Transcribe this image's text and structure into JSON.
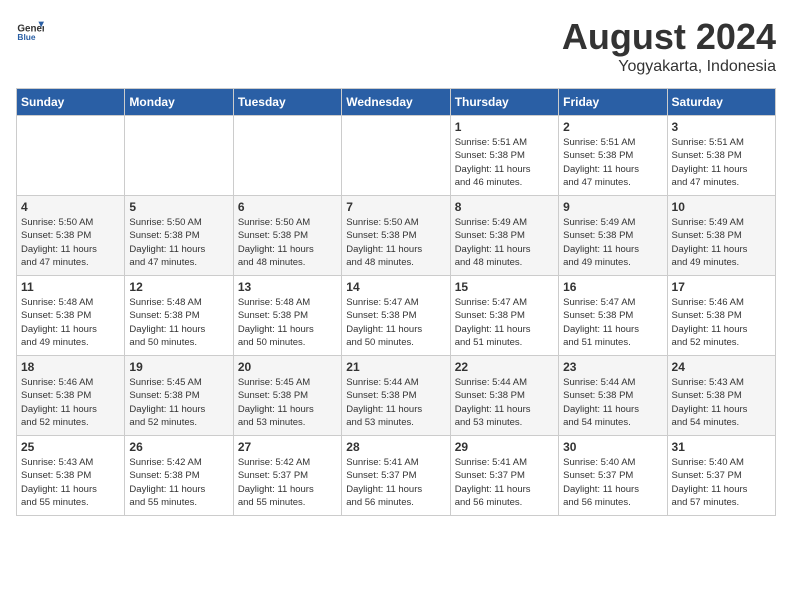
{
  "logo": {
    "general": "General",
    "blue": "Blue"
  },
  "title": "August 2024",
  "subtitle": "Yogyakarta, Indonesia",
  "days_of_week": [
    "Sunday",
    "Monday",
    "Tuesday",
    "Wednesday",
    "Thursday",
    "Friday",
    "Saturday"
  ],
  "weeks": [
    [
      {
        "day": "",
        "info": ""
      },
      {
        "day": "",
        "info": ""
      },
      {
        "day": "",
        "info": ""
      },
      {
        "day": "",
        "info": ""
      },
      {
        "day": "1",
        "info": "Sunrise: 5:51 AM\nSunset: 5:38 PM\nDaylight: 11 hours\nand 46 minutes."
      },
      {
        "day": "2",
        "info": "Sunrise: 5:51 AM\nSunset: 5:38 PM\nDaylight: 11 hours\nand 47 minutes."
      },
      {
        "day": "3",
        "info": "Sunrise: 5:51 AM\nSunset: 5:38 PM\nDaylight: 11 hours\nand 47 minutes."
      }
    ],
    [
      {
        "day": "4",
        "info": "Sunrise: 5:50 AM\nSunset: 5:38 PM\nDaylight: 11 hours\nand 47 minutes."
      },
      {
        "day": "5",
        "info": "Sunrise: 5:50 AM\nSunset: 5:38 PM\nDaylight: 11 hours\nand 47 minutes."
      },
      {
        "day": "6",
        "info": "Sunrise: 5:50 AM\nSunset: 5:38 PM\nDaylight: 11 hours\nand 48 minutes."
      },
      {
        "day": "7",
        "info": "Sunrise: 5:50 AM\nSunset: 5:38 PM\nDaylight: 11 hours\nand 48 minutes."
      },
      {
        "day": "8",
        "info": "Sunrise: 5:49 AM\nSunset: 5:38 PM\nDaylight: 11 hours\nand 48 minutes."
      },
      {
        "day": "9",
        "info": "Sunrise: 5:49 AM\nSunset: 5:38 PM\nDaylight: 11 hours\nand 49 minutes."
      },
      {
        "day": "10",
        "info": "Sunrise: 5:49 AM\nSunset: 5:38 PM\nDaylight: 11 hours\nand 49 minutes."
      }
    ],
    [
      {
        "day": "11",
        "info": "Sunrise: 5:48 AM\nSunset: 5:38 PM\nDaylight: 11 hours\nand 49 minutes."
      },
      {
        "day": "12",
        "info": "Sunrise: 5:48 AM\nSunset: 5:38 PM\nDaylight: 11 hours\nand 50 minutes."
      },
      {
        "day": "13",
        "info": "Sunrise: 5:48 AM\nSunset: 5:38 PM\nDaylight: 11 hours\nand 50 minutes."
      },
      {
        "day": "14",
        "info": "Sunrise: 5:47 AM\nSunset: 5:38 PM\nDaylight: 11 hours\nand 50 minutes."
      },
      {
        "day": "15",
        "info": "Sunrise: 5:47 AM\nSunset: 5:38 PM\nDaylight: 11 hours\nand 51 minutes."
      },
      {
        "day": "16",
        "info": "Sunrise: 5:47 AM\nSunset: 5:38 PM\nDaylight: 11 hours\nand 51 minutes."
      },
      {
        "day": "17",
        "info": "Sunrise: 5:46 AM\nSunset: 5:38 PM\nDaylight: 11 hours\nand 52 minutes."
      }
    ],
    [
      {
        "day": "18",
        "info": "Sunrise: 5:46 AM\nSunset: 5:38 PM\nDaylight: 11 hours\nand 52 minutes."
      },
      {
        "day": "19",
        "info": "Sunrise: 5:45 AM\nSunset: 5:38 PM\nDaylight: 11 hours\nand 52 minutes."
      },
      {
        "day": "20",
        "info": "Sunrise: 5:45 AM\nSunset: 5:38 PM\nDaylight: 11 hours\nand 53 minutes."
      },
      {
        "day": "21",
        "info": "Sunrise: 5:44 AM\nSunset: 5:38 PM\nDaylight: 11 hours\nand 53 minutes."
      },
      {
        "day": "22",
        "info": "Sunrise: 5:44 AM\nSunset: 5:38 PM\nDaylight: 11 hours\nand 53 minutes."
      },
      {
        "day": "23",
        "info": "Sunrise: 5:44 AM\nSunset: 5:38 PM\nDaylight: 11 hours\nand 54 minutes."
      },
      {
        "day": "24",
        "info": "Sunrise: 5:43 AM\nSunset: 5:38 PM\nDaylight: 11 hours\nand 54 minutes."
      }
    ],
    [
      {
        "day": "25",
        "info": "Sunrise: 5:43 AM\nSunset: 5:38 PM\nDaylight: 11 hours\nand 55 minutes."
      },
      {
        "day": "26",
        "info": "Sunrise: 5:42 AM\nSunset: 5:38 PM\nDaylight: 11 hours\nand 55 minutes."
      },
      {
        "day": "27",
        "info": "Sunrise: 5:42 AM\nSunset: 5:37 PM\nDaylight: 11 hours\nand 55 minutes."
      },
      {
        "day": "28",
        "info": "Sunrise: 5:41 AM\nSunset: 5:37 PM\nDaylight: 11 hours\nand 56 minutes."
      },
      {
        "day": "29",
        "info": "Sunrise: 5:41 AM\nSunset: 5:37 PM\nDaylight: 11 hours\nand 56 minutes."
      },
      {
        "day": "30",
        "info": "Sunrise: 5:40 AM\nSunset: 5:37 PM\nDaylight: 11 hours\nand 56 minutes."
      },
      {
        "day": "31",
        "info": "Sunrise: 5:40 AM\nSunset: 5:37 PM\nDaylight: 11 hours\nand 57 minutes."
      }
    ]
  ]
}
